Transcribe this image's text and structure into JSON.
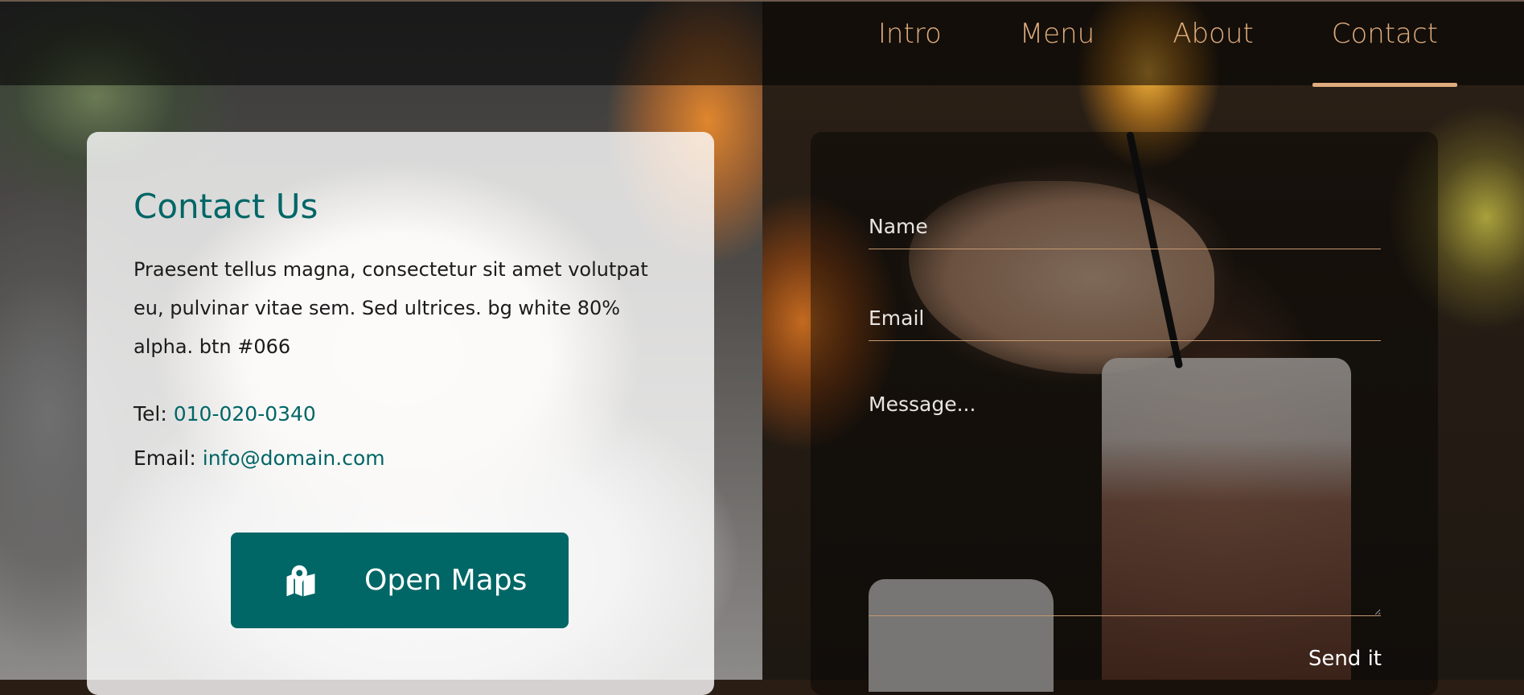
{
  "nav": {
    "items": [
      {
        "label": "Intro",
        "active": false
      },
      {
        "label": "Menu",
        "active": false
      },
      {
        "label": "About",
        "active": false
      },
      {
        "label": "Contact",
        "active": true
      }
    ]
  },
  "contact": {
    "title": "Contact Us",
    "description": "Praesent tellus magna, consectetur sit amet volutpat eu, pulvinar vitae sem. Sed ultrices. bg white 80% alpha. btn #066",
    "tel_label": "Tel:",
    "tel_value": "010-020-0340",
    "email_label": "Email:",
    "email_value": "info@domain.com",
    "maps_button": {
      "label": "Open Maps",
      "icon": "map-marker-icon"
    }
  },
  "form": {
    "name_placeholder": "Name",
    "email_placeholder": "Email",
    "message_placeholder": "Message...",
    "submit_label": "Send it"
  },
  "colors": {
    "accent": "#e0ad7e",
    "brand": "#006666",
    "field_border": "#c69870"
  }
}
